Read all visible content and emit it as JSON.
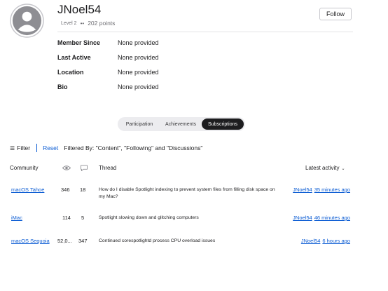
{
  "profile": {
    "username": "JNoel54",
    "level": "Level 2",
    "points": "202 points",
    "follow_label": "Follow",
    "info": [
      {
        "label": "Member Since",
        "value": "None provided"
      },
      {
        "label": "Last Active",
        "value": "None provided"
      },
      {
        "label": "Location",
        "value": "None provided"
      },
      {
        "label": "Bio",
        "value": "None provided"
      }
    ]
  },
  "tabs": [
    {
      "label": "Participation",
      "active": false
    },
    {
      "label": "Achievements",
      "active": false
    },
    {
      "label": "Subscriptions",
      "active": true
    }
  ],
  "filter": {
    "filter_label": "Filter",
    "reset_label": "Reset",
    "filtered_by": "Filtered By: \"Content\", \"Following\" and \"Discussions\""
  },
  "table": {
    "headers": {
      "community": "Community",
      "views_icon": "eye-icon",
      "replies_icon": "speech-bubble-icon",
      "thread": "Thread",
      "latest_activity": "Latest activity"
    },
    "rows": [
      {
        "community": "macOS Tahoe",
        "views": "346",
        "replies": "18",
        "thread": "How do I disable Spotlight indexing to prevent system files from filling disk space on my Mac?",
        "user": "JNoel54",
        "time": "35 minutes ago"
      },
      {
        "community": "iMac",
        "views": "114",
        "replies": "5",
        "thread": "Spotlight slowing down and glitching computers",
        "user": "JNoel54",
        "time": "46 minutes ago"
      },
      {
        "community": "macOS Sequoia",
        "views": "52,0...",
        "replies": "347",
        "thread": "Continued corespotlightd process CPU overload issues",
        "user": "JNoel54",
        "time": "6 hours ago"
      }
    ]
  },
  "colors": {
    "link": "#0a5bd3",
    "active_tab": "#1d1d1f"
  }
}
